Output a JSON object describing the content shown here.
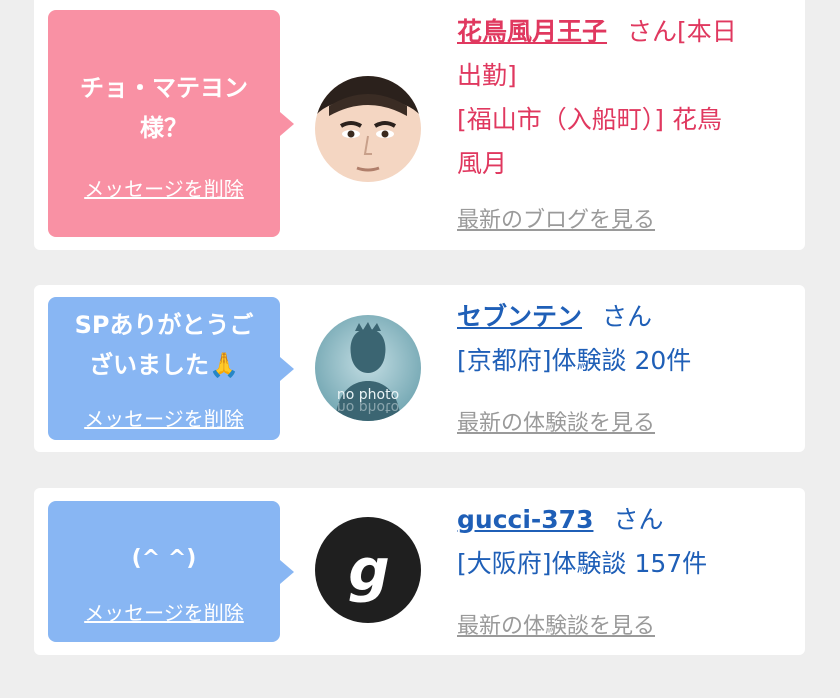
{
  "entries": [
    {
      "bubble_message": "チョ・マテヨン様？",
      "bubble_message_line1": "チョ・マテヨン",
      "bubble_message_line2": "様？",
      "delete_label": "メッセージを削除",
      "name": "花鳥風月王子",
      "honorific": "さん[本日",
      "desc_lines": [
        "出勤]",
        "[福山市（入船町）] 花鳥",
        "風月"
      ],
      "more_link": "最新のブログを見る",
      "avatar": "face-photo",
      "accent_color": "#e0385f",
      "bubble_color": "#f991a4"
    },
    {
      "bubble_message_line1": "SPありがとうご",
      "bubble_message_line2": "ざいました🙏",
      "delete_label": "メッセージを削除",
      "name": "セブンテン",
      "honorific": "さん",
      "desc_lines": [
        "[京都府]体験談 20件"
      ],
      "more_link": "最新の体験談を見る",
      "avatar": "no photo",
      "accent_color": "#1f5fb7",
      "bubble_color": "#88b6f3"
    },
    {
      "bubble_message_line1": "(^ ^)",
      "delete_label": "メッセージを削除",
      "name": "gucci-373",
      "honorific": "さん",
      "desc_lines": [
        "[大阪府]体験談 157件"
      ],
      "more_link": "最新の体験談を見る",
      "avatar": "g",
      "accent_color": "#1f5fb7",
      "bubble_color": "#88b6f3"
    }
  ]
}
